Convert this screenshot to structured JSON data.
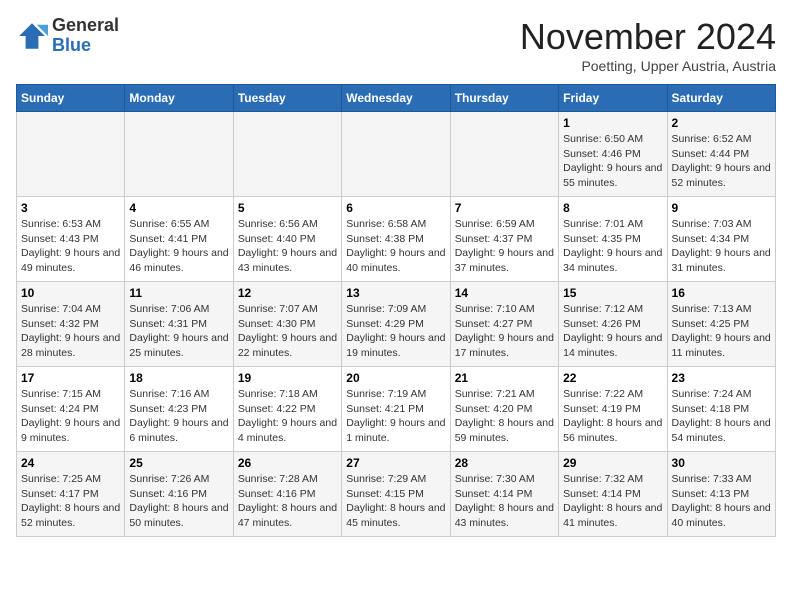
{
  "header": {
    "logo_line1": "General",
    "logo_line2": "Blue",
    "month_title": "November 2024",
    "subtitle": "Poetting, Upper Austria, Austria"
  },
  "days_of_week": [
    "Sunday",
    "Monday",
    "Tuesday",
    "Wednesday",
    "Thursday",
    "Friday",
    "Saturday"
  ],
  "weeks": [
    [
      {
        "day": "",
        "info": ""
      },
      {
        "day": "",
        "info": ""
      },
      {
        "day": "",
        "info": ""
      },
      {
        "day": "",
        "info": ""
      },
      {
        "day": "",
        "info": ""
      },
      {
        "day": "1",
        "info": "Sunrise: 6:50 AM\nSunset: 4:46 PM\nDaylight: 9 hours and 55 minutes."
      },
      {
        "day": "2",
        "info": "Sunrise: 6:52 AM\nSunset: 4:44 PM\nDaylight: 9 hours and 52 minutes."
      }
    ],
    [
      {
        "day": "3",
        "info": "Sunrise: 6:53 AM\nSunset: 4:43 PM\nDaylight: 9 hours and 49 minutes."
      },
      {
        "day": "4",
        "info": "Sunrise: 6:55 AM\nSunset: 4:41 PM\nDaylight: 9 hours and 46 minutes."
      },
      {
        "day": "5",
        "info": "Sunrise: 6:56 AM\nSunset: 4:40 PM\nDaylight: 9 hours and 43 minutes."
      },
      {
        "day": "6",
        "info": "Sunrise: 6:58 AM\nSunset: 4:38 PM\nDaylight: 9 hours and 40 minutes."
      },
      {
        "day": "7",
        "info": "Sunrise: 6:59 AM\nSunset: 4:37 PM\nDaylight: 9 hours and 37 minutes."
      },
      {
        "day": "8",
        "info": "Sunrise: 7:01 AM\nSunset: 4:35 PM\nDaylight: 9 hours and 34 minutes."
      },
      {
        "day": "9",
        "info": "Sunrise: 7:03 AM\nSunset: 4:34 PM\nDaylight: 9 hours and 31 minutes."
      }
    ],
    [
      {
        "day": "10",
        "info": "Sunrise: 7:04 AM\nSunset: 4:32 PM\nDaylight: 9 hours and 28 minutes."
      },
      {
        "day": "11",
        "info": "Sunrise: 7:06 AM\nSunset: 4:31 PM\nDaylight: 9 hours and 25 minutes."
      },
      {
        "day": "12",
        "info": "Sunrise: 7:07 AM\nSunset: 4:30 PM\nDaylight: 9 hours and 22 minutes."
      },
      {
        "day": "13",
        "info": "Sunrise: 7:09 AM\nSunset: 4:29 PM\nDaylight: 9 hours and 19 minutes."
      },
      {
        "day": "14",
        "info": "Sunrise: 7:10 AM\nSunset: 4:27 PM\nDaylight: 9 hours and 17 minutes."
      },
      {
        "day": "15",
        "info": "Sunrise: 7:12 AM\nSunset: 4:26 PM\nDaylight: 9 hours and 14 minutes."
      },
      {
        "day": "16",
        "info": "Sunrise: 7:13 AM\nSunset: 4:25 PM\nDaylight: 9 hours and 11 minutes."
      }
    ],
    [
      {
        "day": "17",
        "info": "Sunrise: 7:15 AM\nSunset: 4:24 PM\nDaylight: 9 hours and 9 minutes."
      },
      {
        "day": "18",
        "info": "Sunrise: 7:16 AM\nSunset: 4:23 PM\nDaylight: 9 hours and 6 minutes."
      },
      {
        "day": "19",
        "info": "Sunrise: 7:18 AM\nSunset: 4:22 PM\nDaylight: 9 hours and 4 minutes."
      },
      {
        "day": "20",
        "info": "Sunrise: 7:19 AM\nSunset: 4:21 PM\nDaylight: 9 hours and 1 minute."
      },
      {
        "day": "21",
        "info": "Sunrise: 7:21 AM\nSunset: 4:20 PM\nDaylight: 8 hours and 59 minutes."
      },
      {
        "day": "22",
        "info": "Sunrise: 7:22 AM\nSunset: 4:19 PM\nDaylight: 8 hours and 56 minutes."
      },
      {
        "day": "23",
        "info": "Sunrise: 7:24 AM\nSunset: 4:18 PM\nDaylight: 8 hours and 54 minutes."
      }
    ],
    [
      {
        "day": "24",
        "info": "Sunrise: 7:25 AM\nSunset: 4:17 PM\nDaylight: 8 hours and 52 minutes."
      },
      {
        "day": "25",
        "info": "Sunrise: 7:26 AM\nSunset: 4:16 PM\nDaylight: 8 hours and 50 minutes."
      },
      {
        "day": "26",
        "info": "Sunrise: 7:28 AM\nSunset: 4:16 PM\nDaylight: 8 hours and 47 minutes."
      },
      {
        "day": "27",
        "info": "Sunrise: 7:29 AM\nSunset: 4:15 PM\nDaylight: 8 hours and 45 minutes."
      },
      {
        "day": "28",
        "info": "Sunrise: 7:30 AM\nSunset: 4:14 PM\nDaylight: 8 hours and 43 minutes."
      },
      {
        "day": "29",
        "info": "Sunrise: 7:32 AM\nSunset: 4:14 PM\nDaylight: 8 hours and 41 minutes."
      },
      {
        "day": "30",
        "info": "Sunrise: 7:33 AM\nSunset: 4:13 PM\nDaylight: 8 hours and 40 minutes."
      }
    ]
  ]
}
